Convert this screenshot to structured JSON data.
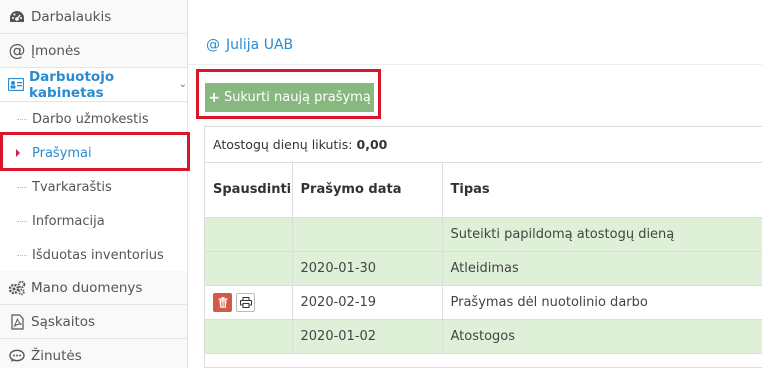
{
  "sidebar": {
    "items": [
      {
        "label": "Darbalaukis",
        "icon": "dashboard-icon"
      },
      {
        "label": "Įmonės",
        "icon": "at-icon"
      },
      {
        "label": "Darbuotojo kabinetas",
        "icon": "id-card-icon",
        "active": true
      },
      {
        "label": "Mano duomenys",
        "icon": "gears-icon"
      },
      {
        "label": "Sąskaitos",
        "icon": "pdf-file-icon"
      },
      {
        "label": "Žinutės",
        "icon": "chat-icon"
      }
    ],
    "submenu": [
      {
        "label": "Darbo užmokestis"
      },
      {
        "label": "Prašymai",
        "selected": true
      },
      {
        "label": "Tvarkaraštis"
      },
      {
        "label": "Informacija"
      },
      {
        "label": "Išduotas inventorius"
      }
    ]
  },
  "main": {
    "company_prefix": "@",
    "company": "Julija UAB",
    "new_request_label": "Sukurti naują prašymą",
    "balance_label": "Atostogų dienų likutis:",
    "balance_value": "0,00",
    "table": {
      "headers": [
        "Spausdinti",
        "Prašymo data",
        "Tipas"
      ],
      "rows": [
        {
          "print": false,
          "date": "",
          "type": "Suteikti papildomą atostogų dieną",
          "green": true
        },
        {
          "print": false,
          "date": "2020-01-30",
          "type": "Atleidimas",
          "green": true
        },
        {
          "print": true,
          "date": "2020-02-19",
          "type": "Prašymas dėl nuotolinio darbo",
          "green": false
        },
        {
          "print": false,
          "date": "2020-01-02",
          "type": "Atostogos",
          "green": true
        }
      ]
    }
  },
  "colors": {
    "accent": "#2a8bd0",
    "button_green": "#87b87f",
    "row_green": "#dff0d8",
    "highlight": "#d9172a",
    "delete_red": "#d15b47"
  }
}
